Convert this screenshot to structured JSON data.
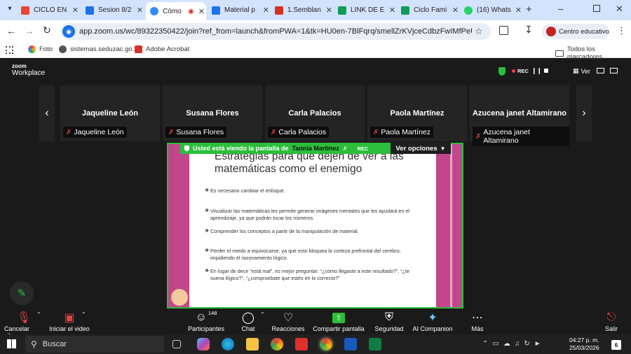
{
  "browser": {
    "tabs": [
      {
        "title": "CICLO EN",
        "color": "#ea4335"
      },
      {
        "title": "Sesion 8/2",
        "color": "#1a73e8"
      },
      {
        "title": "Cómo",
        "color": "#2d8cff",
        "active": true
      },
      {
        "title": "Material p",
        "color": "#1a73e8"
      },
      {
        "title": "1.Semblan",
        "color": "#d93025"
      },
      {
        "title": "LINK DE E",
        "color": "#0f9d58"
      },
      {
        "title": "Ciclo Fami",
        "color": "#0f9d58"
      },
      {
        "title": "(16) Whats",
        "color": "#25d366"
      }
    ],
    "url": "app.zoom.us/wc/89322350422/join?ref_from=launch&fromPWA=1&tk=HU0en-7BlFqrq/smellZrKVjceCdbzFwIMfPeUhs94.DQ...",
    "profile_label": "Centro educativo",
    "bookmarks": [
      "Foto",
      "sistemas.seduzac.go...",
      "Adobe Acrobat"
    ],
    "all_bookmarks": "Todos los marcadores"
  },
  "zoom": {
    "logo_top": "zoom",
    "logo_bottom": "Workplace",
    "rec": "REC",
    "view_label": "Ver",
    "participants": [
      {
        "name": "Jaqueline León",
        "label": "Jaqueline León"
      },
      {
        "name": "Susana Flores",
        "label": "Susana Flores"
      },
      {
        "name": "Carla Palacios",
        "label": "Carla Palacios"
      },
      {
        "name": "Paola Martínez",
        "label": "Paola Martínez"
      },
      {
        "name": "Azucena janet Altamirano",
        "label": "Azucena janet Altamirano"
      }
    ],
    "share_bar": {
      "text": "Usted está viendo la pantalla de",
      "presenter": "Tannia Martinez",
      "rec": "REC",
      "view_options": "Ver opciones"
    },
    "slide": {
      "title": "Estrategias para que dejen de ver a las matemáticas como el enemigo",
      "bullets": [
        "Es necesario cambiar el enfoque.",
        "Visualizar las matemáticas les permite generar imágenes mentales que les ayudará en el aprendizaje, ya que podrán tocar los números.",
        "Comprender los conceptos a partir de la manipulación de material.",
        "Perder el miedo a equivocarse, ya que esto bloquea la corteza prefrontal del cerebro, impidiendo el razonamiento lógico.",
        "En lugar de decir “está mal”, es mejor preguntar: “¿cómo llegaste a este resultado?”, “¿te suena lógico?”, “¿compruebate que estés en lo correcto?”"
      ]
    },
    "controls": {
      "mute": "Cancelar sile...",
      "video": "Iniciar el video",
      "participants": "Participantes",
      "participants_count": "148",
      "chat": "Chat",
      "reactions": "Reacciones",
      "share": "Compartir pantalla",
      "security": "Seguridad",
      "ai": "AI Companion",
      "more": "Más",
      "leave": "Salir"
    }
  },
  "taskbar": {
    "search": "Buscar",
    "time": "04:27 p. m.",
    "date": "25/03/2026",
    "notif": "6"
  }
}
